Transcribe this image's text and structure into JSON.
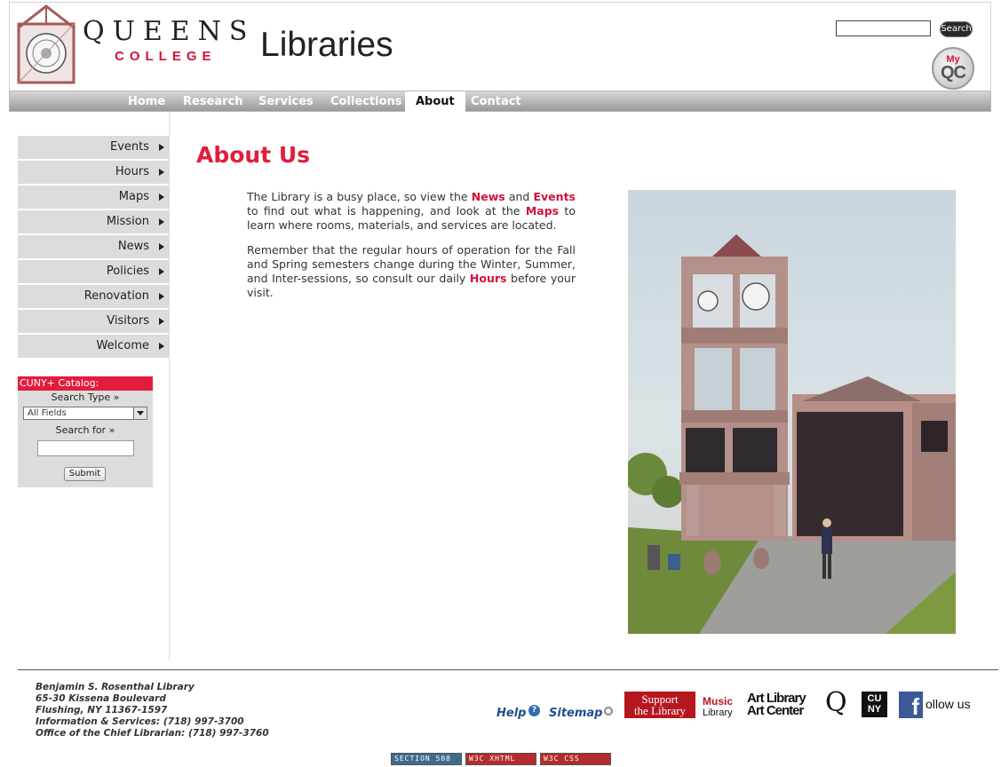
{
  "header": {
    "college_name": "QUEENS",
    "college_sub": "COLLEGE",
    "site_title": "Libraries",
    "search_button": "Search",
    "myqc_my": "My",
    "myqc_qc": "QC"
  },
  "nav": {
    "tabs": [
      "Home",
      "Research",
      "Services",
      "Collections",
      "About",
      "Contact"
    ],
    "active": "About"
  },
  "sidebar": {
    "items": [
      "Events",
      "Hours",
      "Maps",
      "Mission",
      "News",
      "Policies",
      "Renovation",
      "Visitors",
      "Welcome"
    ]
  },
  "catalog": {
    "title": "CUNY+ Catalog:",
    "search_type_label": "Search Type »",
    "search_type_value": "All Fields",
    "search_for_label": "Search for »",
    "submit_label": "Submit"
  },
  "main": {
    "title": "About Us",
    "p1_a": "The Library is a busy place, so view the ",
    "p1_news": "News",
    "p1_b": " and ",
    "p1_events": "Events",
    "p1_c": " to find out what is happening, and look at the ",
    "p1_maps": "Maps",
    "p1_d": " to learn where rooms, materials, and services are located.",
    "p2_a": "Remember that the regular hours of operation for the Fall and Spring semesters change during the Winter, Summer, and Inter-sessions, so consult our daily ",
    "p2_hours": "Hours",
    "p2_b": " before your visit."
  },
  "footer": {
    "address_lines": [
      "Benjamin S. Rosenthal Library",
      "65-30 Kissena Boulevard",
      "Flushing, NY 11367-1597",
      "Information & Services: (718) 997-3700",
      "Office of the Chief Librarian: (718) 997-3760"
    ],
    "help": "Help",
    "sitemap": "Sitemap",
    "support_line1": "Support",
    "support_line2": "the Library",
    "music_line1": "Music",
    "music_line2": "Library",
    "art_line1": "Art Library",
    "art_line2": "Art Center",
    "q_logo": "Q",
    "cuny_logo": "CU NY",
    "fb_letter": "f",
    "follow": "ollow us",
    "badges": [
      "SECTION 508",
      "W3C XHTML",
      "W3C CSS"
    ]
  },
  "colors": {
    "accent_red": "#e31c3d",
    "link_blue": "#1e4f8c",
    "nav_gray": "#9a9a9a",
    "sidebar_gray": "#dcdcdc"
  }
}
